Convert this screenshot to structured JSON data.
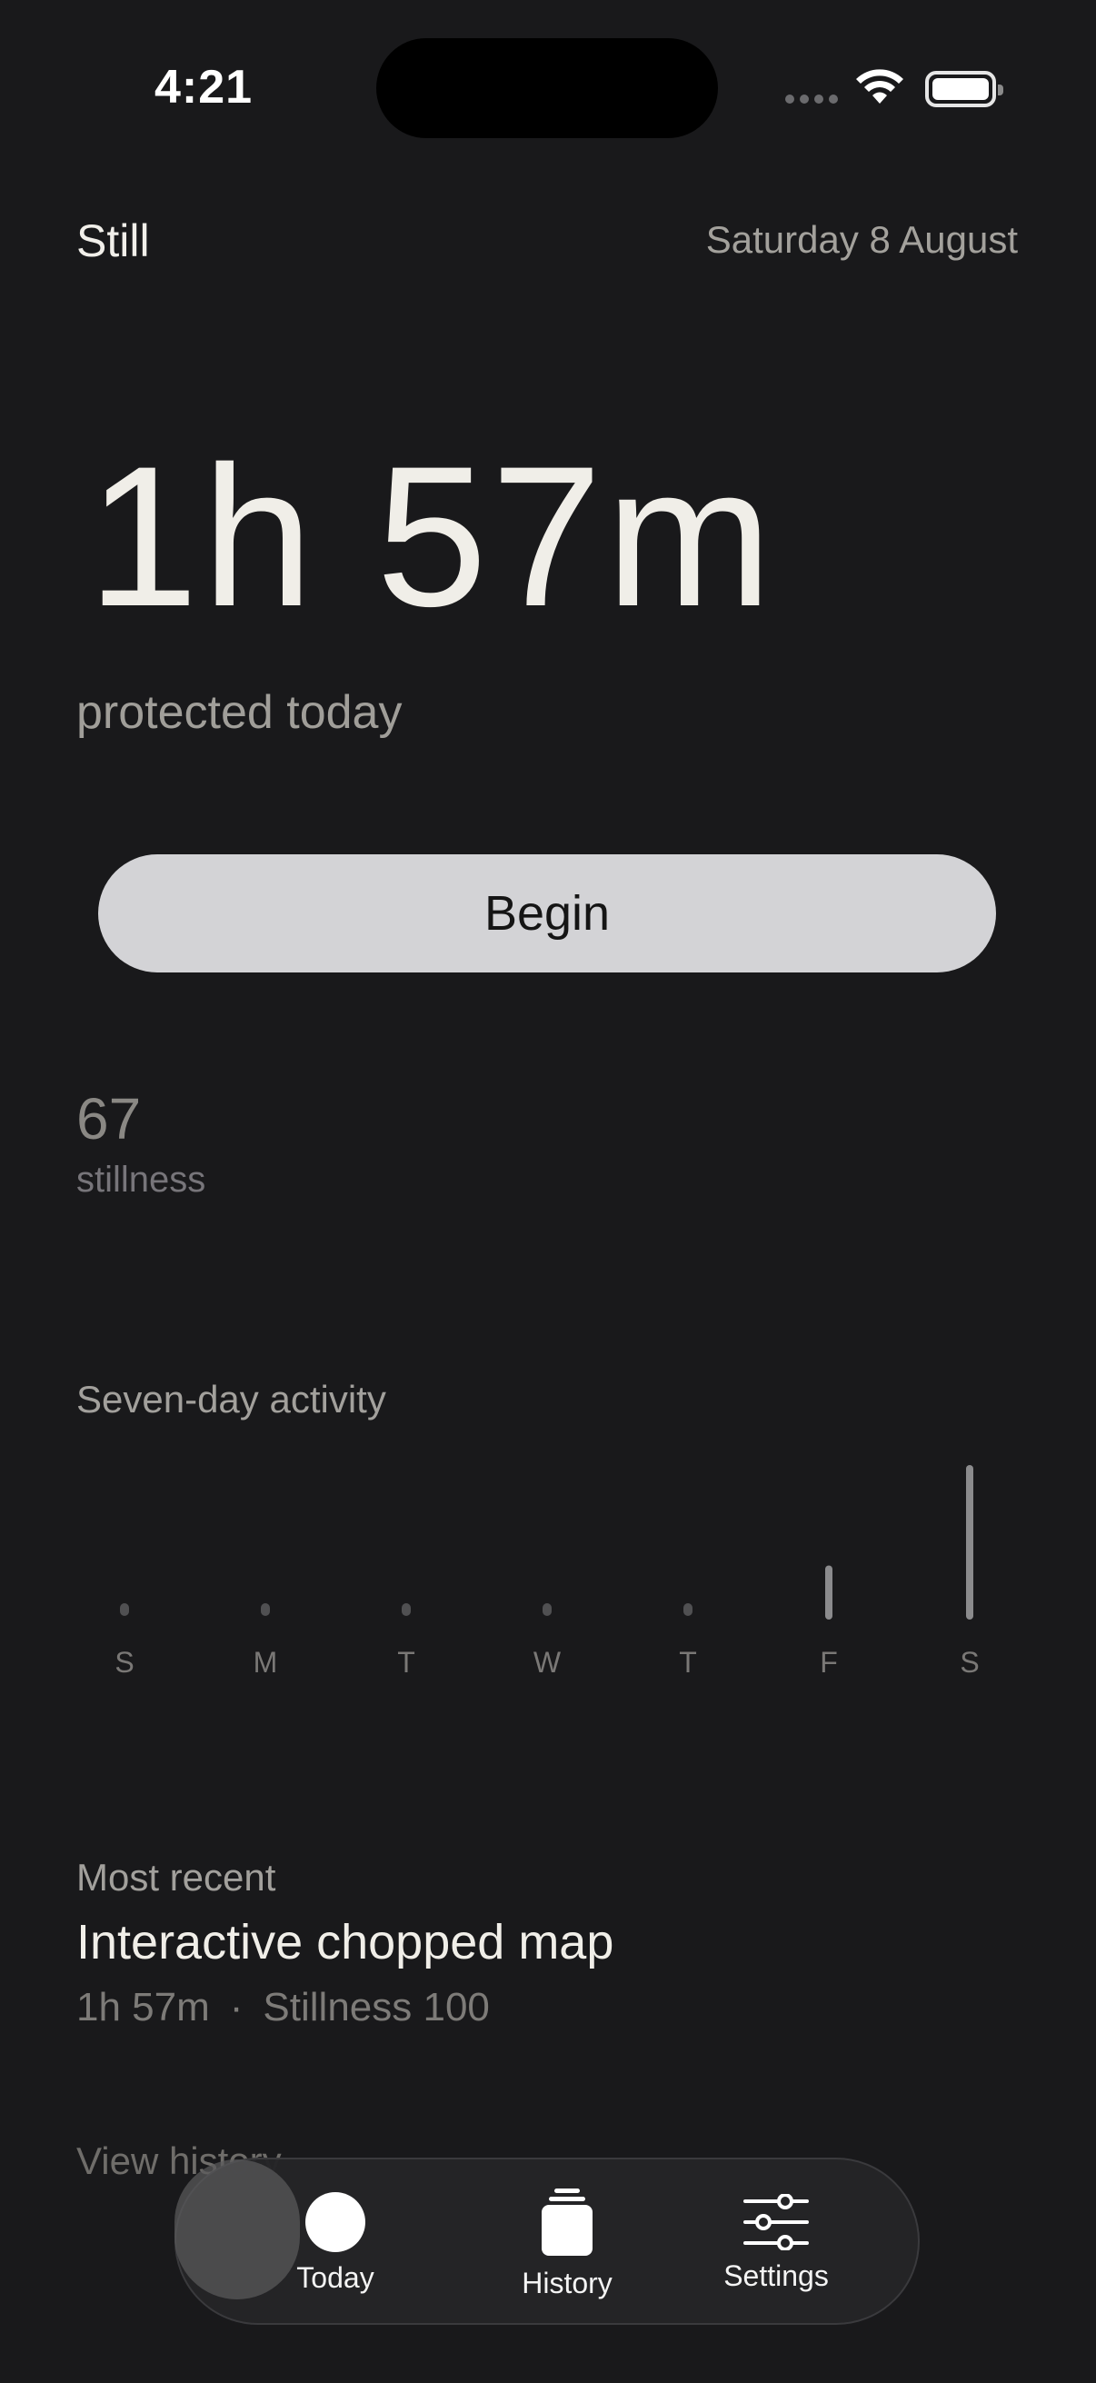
{
  "status_bar": {
    "time": "4:21"
  },
  "header": {
    "app_name": "Still",
    "date": "Saturday 8 August"
  },
  "hero": {
    "duration": "1h 57m",
    "caption": "protected today"
  },
  "actions": {
    "begin_label": "Begin"
  },
  "stillness": {
    "value": "67",
    "label": "stillness"
  },
  "activity": {
    "title": "Seven-day activity"
  },
  "chart_data": {
    "type": "bar",
    "title": "Seven-day activity",
    "categories": [
      "S",
      "M",
      "T",
      "W",
      "T",
      "F",
      "S"
    ],
    "values": [
      0,
      0,
      0,
      0,
      0,
      0.35,
      1.0
    ],
    "xlabel": "",
    "ylabel": "",
    "grid": false,
    "color": "#8b8b8d"
  },
  "recent": {
    "label": "Most recent",
    "title": "Interactive chopped map",
    "duration": "1h 57m",
    "separator": "·",
    "stillness": "Stillness 100"
  },
  "links": {
    "view_history": "View history"
  },
  "tabs": [
    {
      "label": "Today",
      "icon": "today-dot-icon"
    },
    {
      "label": "History",
      "icon": "history-stack-icon"
    },
    {
      "label": "Settings",
      "icon": "sliders-icon"
    }
  ],
  "colors": {
    "background": "#19191b",
    "button": "#d3d3d6",
    "tab_bar": "#242426"
  }
}
